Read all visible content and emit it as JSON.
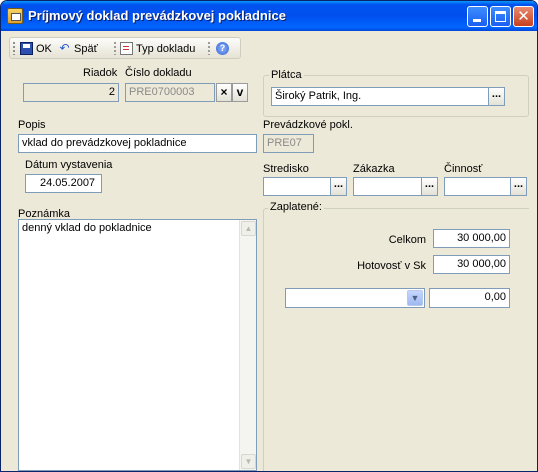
{
  "window": {
    "title": "Príjmový doklad prevádzkovej pokladnice"
  },
  "toolbar": {
    "ok_label": "OK",
    "back_label": "Späť",
    "doc_type_label": "Typ dokladu"
  },
  "header": {
    "riadok_label": "Riadok",
    "riadok_value": "2",
    "cislo_label": "Číslo dokladu",
    "cislo_value": "PRE0700003",
    "delete_symbol": "×",
    "down_symbol": "v"
  },
  "platca": {
    "label": "Plátca",
    "value": "Široký Patrik, Ing.",
    "browse": "..."
  },
  "popis": {
    "label": "Popis",
    "value": "vklad do prevádzkovej pokladnice"
  },
  "prevadzkove": {
    "label": "Prevádzkové pokl.",
    "value": "PRE07"
  },
  "datum": {
    "label": "Dátum vystavenia",
    "value": "24.05.2007"
  },
  "codes": {
    "stredisko_label": "Stredisko",
    "zakazka_label": "Zákazka",
    "cinnost_label": "Činnosť",
    "browse": "..."
  },
  "poznamka": {
    "label": "Poznámka",
    "value": "denný vklad do pokladnice"
  },
  "zaplatene": {
    "title": "Zaplatené:",
    "celkom_label": "Celkom",
    "celkom_value": "30 000,00",
    "hotovost_label": "Hotovosť v Sk",
    "hotovost_value": "30 000,00",
    "combo_value": "",
    "other_value": "0,00"
  },
  "colors": {
    "titlebar": "#0054e3",
    "window_bg": "#ece9d8",
    "field_border": "#7f9db9"
  },
  "icons": {
    "ok": "save-disk-icon",
    "back": "undo-arrow-icon",
    "doc_type": "document-icon",
    "help": "help-icon"
  }
}
